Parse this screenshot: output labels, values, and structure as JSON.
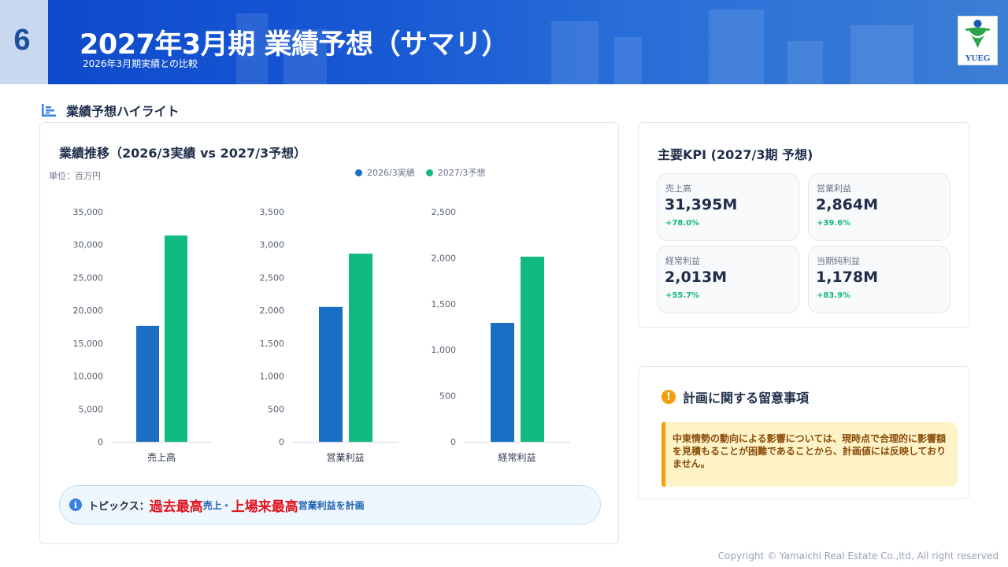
{
  "header": {
    "page_number": "6",
    "title": "2027年3月期 業績予想（サマリ）",
    "subtitle": "2026年3月期実績との比較",
    "logo_text": "YUEG"
  },
  "section": {
    "title": "業績予想ハイライト"
  },
  "chart_card": {
    "title": "業績推移（2026/3実績 vs 2027/3予想）",
    "unit": "単位：百万円"
  },
  "chart_data": {
    "type": "bar",
    "legend": [
      {
        "name": "2026/3実績",
        "color": "#1a6fc4"
      },
      {
        "name": "2027/3予想",
        "color": "#12b981"
      }
    ],
    "panels": [
      {
        "category": "売上高",
        "ylim": [
          0,
          35000
        ],
        "yticks": [
          0,
          5000,
          10000,
          15000,
          20000,
          25000,
          30000,
          35000
        ],
        "ytick_labels": [
          "0",
          "5,000",
          "10,000",
          "15,000",
          "20,000",
          "25,000",
          "30,000",
          "35,000"
        ],
        "values": [
          17638,
          31395
        ]
      },
      {
        "category": "営業利益",
        "ylim": [
          0,
          3500
        ],
        "yticks": [
          0,
          500,
          1000,
          1500,
          2000,
          2500,
          3000,
          3500
        ],
        "ytick_labels": [
          "0",
          "500",
          "1,000",
          "1,500",
          "2,000",
          "2,500",
          "3,000",
          "3,500"
        ],
        "values": [
          2052,
          2864
        ]
      },
      {
        "category": "経常利益",
        "ylim": [
          0,
          2500
        ],
        "yticks": [
          0,
          500,
          1000,
          1500,
          2000,
          2500
        ],
        "ytick_labels": [
          "0",
          "500",
          "1,000",
          "1,500",
          "2,000",
          "2,500"
        ],
        "values": [
          1293,
          2013
        ]
      }
    ]
  },
  "topics": {
    "label": "トピックス：",
    "highlight1": "過去最高",
    "text1": "売上・",
    "highlight2": "上場来最高",
    "text2": "営業利益を計画"
  },
  "kpi": {
    "title": "主要KPI (2027/3期 予想)",
    "items": [
      {
        "label": "売上高",
        "value": "31,395M",
        "change": "+78.0%"
      },
      {
        "label": "営業利益",
        "value": "2,864M",
        "change": "+39.6%"
      },
      {
        "label": "経常利益",
        "value": "2,013M",
        "change": "+55.7%"
      },
      {
        "label": "当期純利益",
        "value": "1,178M",
        "change": "+83.9%"
      }
    ]
  },
  "note": {
    "icon": "!",
    "title": "計画に関する留意事項",
    "text": "中東情勢の動向による影響については、現時点で合理的に影響額を見積もることが困難であることから、計画値には反映しておりません。"
  },
  "footer": {
    "copyright": "Copyright © Yamaichi Real Estate Co.,ltd, All right reserved"
  }
}
